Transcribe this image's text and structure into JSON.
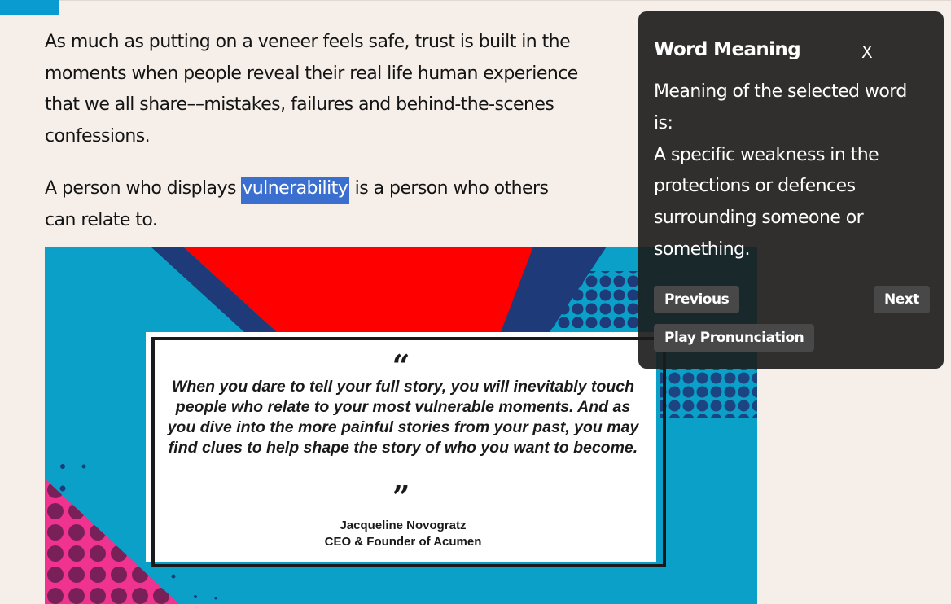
{
  "article": {
    "paragraph1": "As much as putting on a veneer feels safe, trust is built in the moments when people reveal their real life human experience that we all share––mistakes, failures and behind-the-scenes confessions.",
    "paragraph2_before": "A person who displays ",
    "selected_word": "vulnerability",
    "paragraph2_after": " is a person who others can relate to."
  },
  "quote_image": {
    "open_mark": "“",
    "quote": "When you dare to tell your full story, you will inevitably touch people who relate to your most vulnerable moments. And as you dive into the more painful stories from your past, you may find clues to help shape the story of who you want to become.",
    "close_mark": "”",
    "author": "Jacqueline Novogratz",
    "role": "CEO & Founder of Acumen"
  },
  "popup": {
    "title": "Word Meaning",
    "close_label": "X",
    "intro": "Meaning of the selected word is:",
    "definition": "A specific weakness in the protections or defences surrounding someone or something.",
    "previous_label": "Previous",
    "next_label": "Next",
    "play_label": "Play Pronunciation"
  },
  "colors": {
    "page_background": "#f6efe9",
    "accent_blue": "#0a9bd0",
    "selection": "#3b6fcf",
    "popup_background": "#1c1c1c",
    "popup_button": "#484848",
    "art_red": "#ff0000",
    "art_navy": "#1e3a78",
    "art_pink": "#f0338f"
  }
}
